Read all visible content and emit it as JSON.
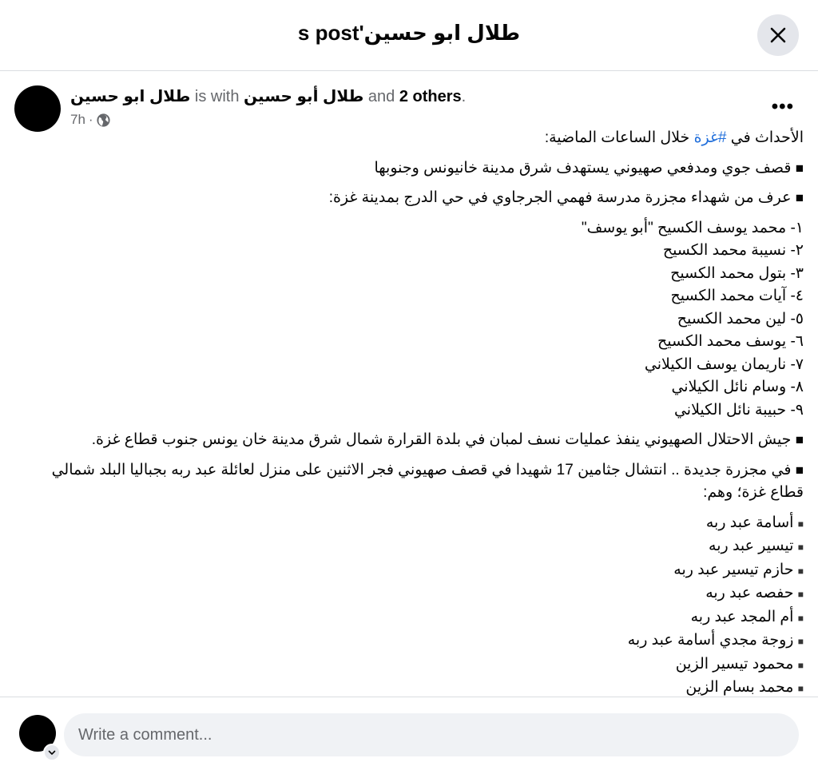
{
  "header": {
    "title": "طلال ابو حسين's post",
    "close_icon": "close-icon"
  },
  "post": {
    "author": "طلال ابو حسين",
    "is_with_text": "is with",
    "tagged": "طلال أبو حسين",
    "and_text": "and",
    "others": "2 others",
    "period": ".",
    "time": "7h",
    "separator": "·",
    "privacy_icon": "globe-icon",
    "more_label": "•••",
    "intro_pre": "الأحداث في ",
    "hashtag": "#غزة",
    "intro_post": " خلال الساعات الماضية:",
    "bullet": "■",
    "small_bullet": "■",
    "item1": "قصف جوي ومدفعي صهيوني يستهدف شرق مدينة خانيونس وجنوبها",
    "item2": "عرف من شهداء مجزرة مدرسة فهمي الجرجاوي في حي الدرج بمدينة غزة:",
    "martyrs1": [
      "١- محمد يوسف الكسيح \"أبو يوسف\"",
      "٢- نسيبة محمد الكسيح",
      "٣- بتول محمد الكسيح",
      "٤- آيات محمد الكسيح",
      "٥- لين محمد الكسيح",
      "٦- يوسف محمد الكسيح",
      "٧- ناريمان يوسف الكيلاني",
      "٨- وسام نائل الكيلاني",
      "٩- حبيبة نائل الكيلاني"
    ],
    "item3": "جيش الاحتلال الصهيوني ينفذ عمليات نسف لمبان في بلدة القرارة شمال شرق مدينة خان يونس جنوب قطاع غزة.",
    "item4": "في مجزرة جديدة .. انتشال جثامين 17 شهيدا في قصف صهيوني فجر الاثنين على منزل لعائلة عبد ربه بجباليا البلد شمالي قطاع غزة؛ وهم:",
    "martyrs2": [
      "أسامة عبد ربه",
      "تيسير عبد ربه",
      "حازم تيسير عبد ربه",
      "حفصه عبد ربه",
      "أم المجد عبد ربه",
      "زوجة مجدي أسامة عبد ربه",
      "محمود تيسير الزين",
      "محمد بسام الزين"
    ]
  },
  "comment": {
    "placeholder": "Write a comment...",
    "chevron_icon": "chevron-down-icon"
  }
}
